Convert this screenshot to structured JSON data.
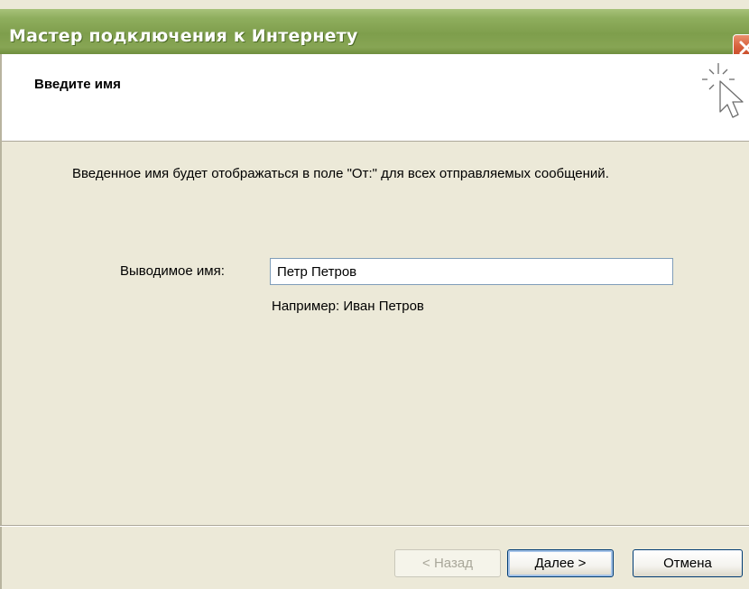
{
  "window": {
    "title": "Мастер подключения к Интернету"
  },
  "header": {
    "title": "Введите имя",
    "icon": "wizard-cursor-icon"
  },
  "content": {
    "description": "Введенное имя будет отображаться в поле \"От:\" для всех отправляемых сообщений.",
    "field_label": "Выводимое имя:",
    "field_value": "Петр Петров",
    "example": "Например: Иван Петров"
  },
  "buttons": {
    "back": "< Назад",
    "next": "Далее >",
    "cancel": "Отмена"
  },
  "colors": {
    "titlebar": "#7E9E4C",
    "background": "#ECE9D8",
    "close": "#D8613D"
  }
}
